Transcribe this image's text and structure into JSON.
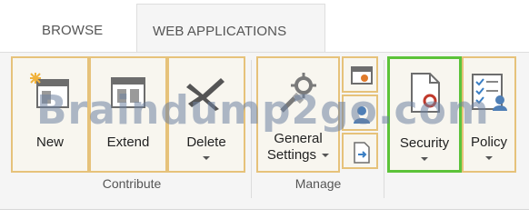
{
  "tabs": {
    "browse": "BROWSE",
    "web_applications": "WEB APPLICATIONS"
  },
  "contribute": {
    "new": "New",
    "extend": "Extend",
    "delete": "Delete",
    "group_label": "Contribute"
  },
  "manage": {
    "general_settings_line1": "General",
    "general_settings_line2": "Settings",
    "group_label": "Manage"
  },
  "security": {
    "security": "Security",
    "policy": "Policy"
  },
  "watermark": "Braindump2go.com",
  "colors": {
    "button_border": "#e6c27a",
    "security_highlight": "#5cc33a",
    "ribbon_bg": "#f5f5f5"
  },
  "icons": [
    "new-web-app-icon",
    "extend-icon",
    "delete-x-icon",
    "gear-icon",
    "service-connections-icon",
    "authentication-providers-icon",
    "self-service-site-icon",
    "security-document-icon",
    "policy-checklist-icon"
  ]
}
